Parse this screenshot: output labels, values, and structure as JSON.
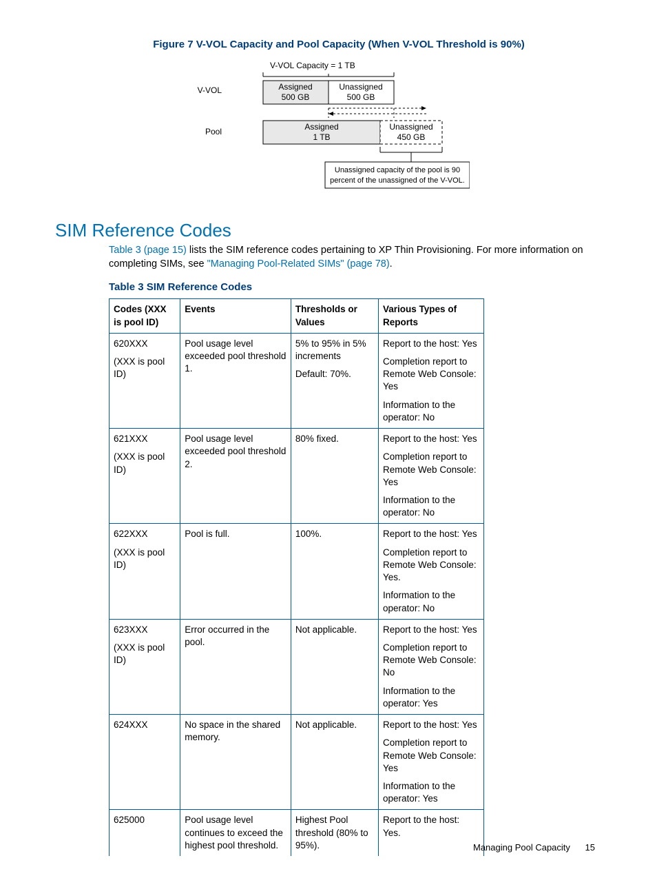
{
  "figure": {
    "title": "Figure 7 V-VOL Capacity and Pool Capacity (When V-VOL Threshold is 90%)",
    "vvol_label": "V-VOL",
    "pool_label": "Pool",
    "vvol_capacity": "V-VOL Capacity = 1 TB",
    "vvol_assigned_lbl": "Assigned",
    "vvol_assigned_val": "500 GB",
    "vvol_unassigned_lbl": "Unassigned",
    "vvol_unassigned_val": "500 GB",
    "pool_assigned_lbl": "Assigned",
    "pool_assigned_val": "1 TB",
    "pool_unassigned_lbl": "Unassigned",
    "pool_unassigned_val": "450 GB",
    "caption_line1": "Unassigned capacity of the pool is 90",
    "caption_line2": "percent of the unassigned of the V-VOL."
  },
  "section": {
    "heading": "SIM Reference Codes",
    "intro_link1": "Table 3 (page 15)",
    "intro_text1": " lists the SIM reference codes pertaining to XP Thin Provisioning. For more information on completing SIMs, see ",
    "intro_link2": "\"Managing Pool-Related SIMs\" (page 78)",
    "intro_text2": "."
  },
  "table": {
    "title": "Table 3 SIM Reference Codes",
    "headers": {
      "codes": "Codes (XXX is pool ID)",
      "events": "Events",
      "thresholds": "Thresholds or Values",
      "reports": "Various Types of Reports"
    },
    "rows": [
      {
        "codes": [
          "620XXX",
          "(XXX is pool ID)"
        ],
        "events": "Pool usage level exceeded pool threshold 1.",
        "thresholds": [
          "5% to 95% in 5% increments",
          "Default: 70%."
        ],
        "reports": [
          "Report to the host: Yes",
          "Completion report to Remote Web Console: Yes",
          "Information to the operator: No"
        ]
      },
      {
        "codes": [
          "621XXX",
          "(XXX is pool ID)"
        ],
        "events": "Pool usage level exceeded pool threshold 2.",
        "thresholds": [
          "80% fixed."
        ],
        "reports": [
          "Report to the host: Yes",
          "Completion report to Remote Web Console: Yes",
          "Information to the operator: No"
        ]
      },
      {
        "codes": [
          "622XXX",
          "(XXX is pool ID)"
        ],
        "events": "Pool is full.",
        "thresholds": [
          "100%."
        ],
        "reports": [
          "Report to the host: Yes",
          "Completion report to Remote Web Console: Yes.",
          "Information to the operator: No"
        ]
      },
      {
        "codes": [
          "623XXX",
          "(XXX is pool ID)"
        ],
        "events": "Error occurred in the pool.",
        "thresholds": [
          "Not applicable."
        ],
        "reports": [
          "Report to the host: Yes",
          "Completion report to Remote Web Console: No",
          "Information to the operator: Yes"
        ]
      },
      {
        "codes": [
          "624XXX"
        ],
        "events": "No space in the shared memory.",
        "thresholds": [
          "Not applicable."
        ],
        "reports": [
          "Report to the host: Yes",
          "Completion report to Remote Web Console: Yes",
          "Information to the operator: Yes"
        ]
      },
      {
        "codes": [
          "625000"
        ],
        "events": "Pool usage level continues to exceed the highest pool threshold.",
        "thresholds": [
          "Highest Pool threshold (80% to 95%)."
        ],
        "reports": [
          "Report to the host: Yes."
        ]
      }
    ]
  },
  "footer": {
    "section": "Managing Pool Capacity",
    "page": "15"
  }
}
